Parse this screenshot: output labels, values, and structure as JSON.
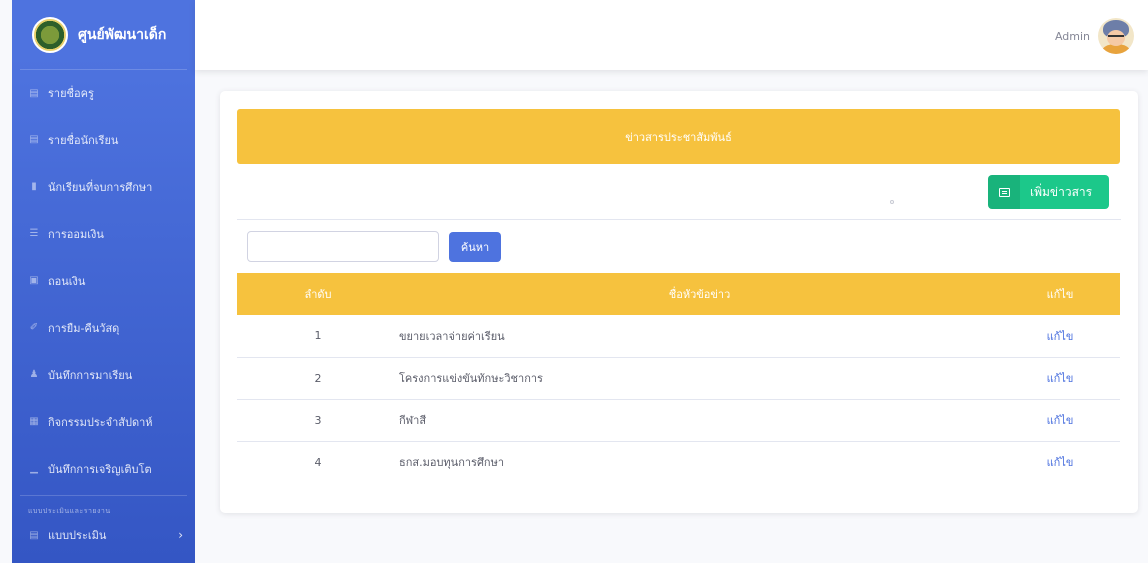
{
  "brand": {
    "name": "ศูนย์พัฒนาเด็ก"
  },
  "sidebar": {
    "items": [
      {
        "label": "รายชื่อครู",
        "icon": "id-card-icon"
      },
      {
        "label": "รายชื่อนักเรียน",
        "icon": "id-card-icon"
      },
      {
        "label": "นักเรียนที่จบการศึกษา",
        "icon": "file-icon"
      },
      {
        "label": "การออมเงิน",
        "icon": "wallet-icon"
      },
      {
        "label": "ถอนเงิน",
        "icon": "money-bill-icon"
      },
      {
        "label": "การยืม-คืนวัสดุ",
        "icon": "pen-icon"
      },
      {
        "label": "บันทึกการมาเรียน",
        "icon": "user-check-icon"
      },
      {
        "label": "กิจกรรมประจำสัปดาห์",
        "icon": "table-icon"
      },
      {
        "label": "บันทึกการเจริญเติบโต",
        "icon": "chart-icon"
      }
    ],
    "heading": "แบบประเมินและรายงาน",
    "sub_item": {
      "label": "แบบประเมิน",
      "icon": "list-icon"
    }
  },
  "topbar": {
    "user_name": "Admin"
  },
  "main": {
    "banner_title": "ข่าวสารประชาสัมพันธ์",
    "add_button_label": "เพิ่มข่าวสาร",
    "search": {
      "value": "",
      "placeholder": "",
      "button_label": "ค้นหา"
    },
    "table": {
      "headers": {
        "no": "ลำดับ",
        "title": "ชื่อหัวข้อข่าว",
        "edit": "แก้ไข"
      },
      "rows": [
        {
          "no": "1",
          "title": "ขยายเวลาจ่ายค่าเรียน",
          "edit": "แก้ไข"
        },
        {
          "no": "2",
          "title": "โครงการแข่งขันทักษะวิชาการ",
          "edit": "แก้ไข"
        },
        {
          "no": "3",
          "title": "กีฬาสี",
          "edit": "แก้ไข"
        },
        {
          "no": "4",
          "title": "ธกส.มอบทุนการศึกษา",
          "edit": "แก้ไข"
        }
      ]
    }
  },
  "colors": {
    "primary": "#4e73df",
    "warning": "#f6c23e",
    "success": "#1cc88a"
  }
}
